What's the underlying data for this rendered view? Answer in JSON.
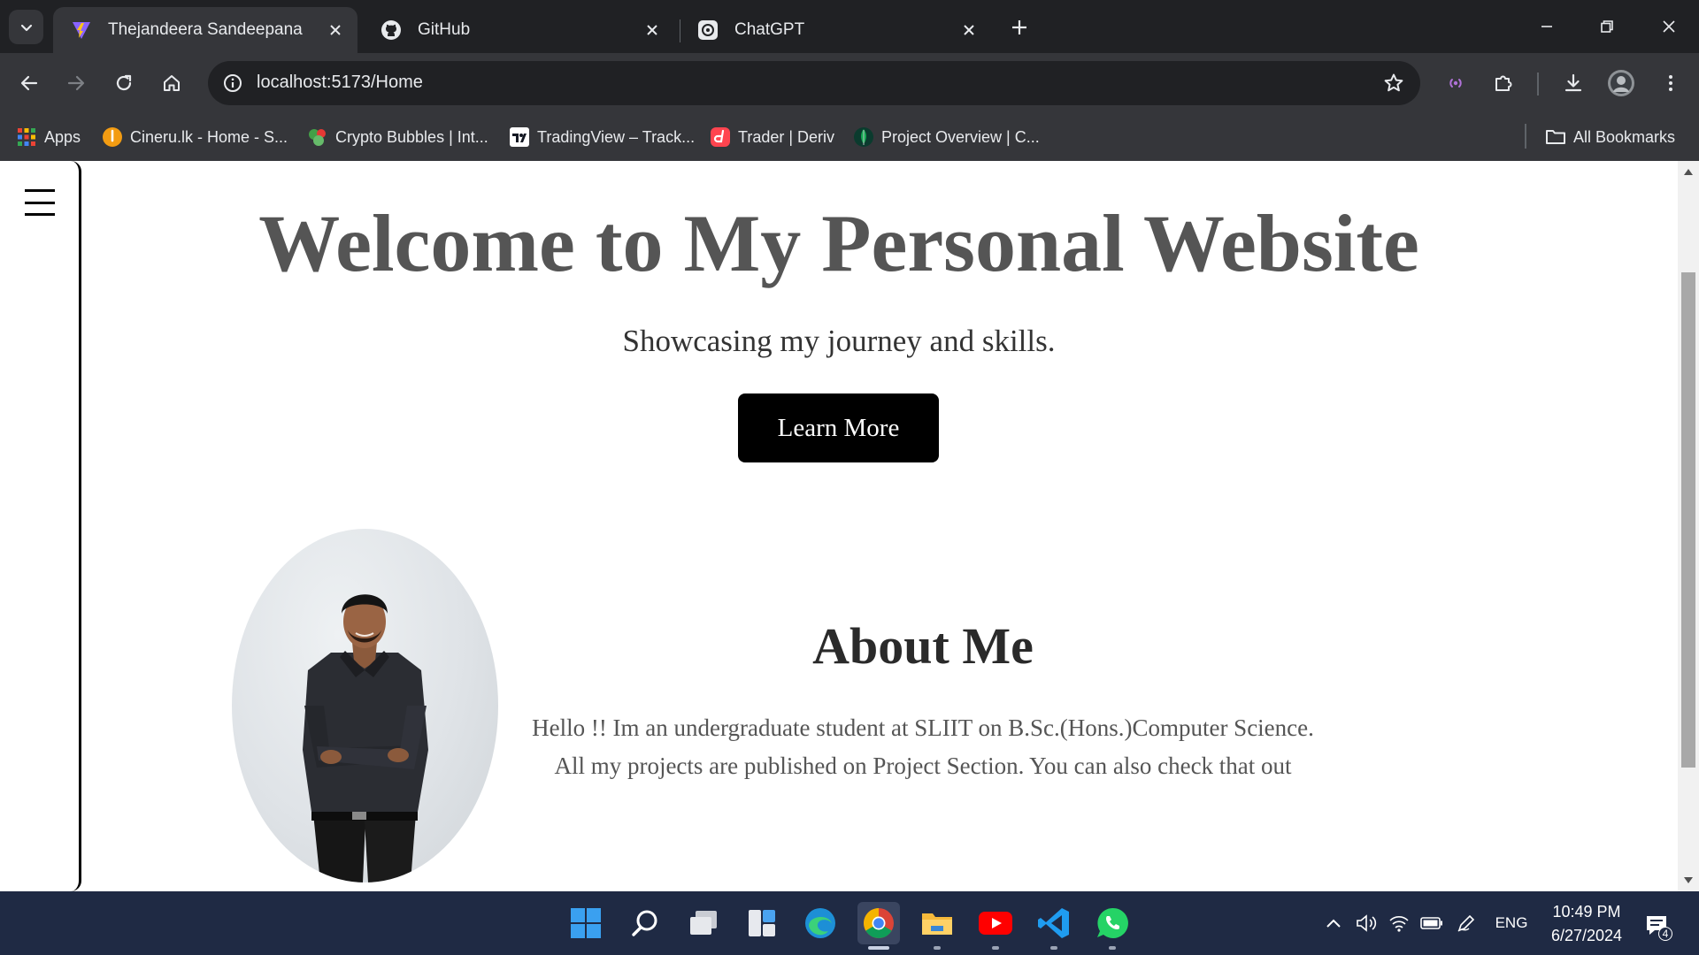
{
  "browser": {
    "tabs": [
      {
        "title": "Thejandeera Sandeepana",
        "icon": "vite-icon",
        "active": true
      },
      {
        "title": "GitHub",
        "icon": "github-icon",
        "active": false
      },
      {
        "title": "ChatGPT",
        "icon": "chatgpt-icon",
        "active": false
      }
    ],
    "url": "localhost:5173/Home",
    "bookmarks": [
      {
        "label": "Apps",
        "icon": "apps-grid-icon"
      },
      {
        "label": "Cineru.lk - Home - S...",
        "icon": "cineru-icon"
      },
      {
        "label": "Crypto Bubbles | Int...",
        "icon": "crypto-bubbles-icon"
      },
      {
        "label": "TradingView – Track...",
        "icon": "tradingview-icon"
      },
      {
        "label": "Trader | Deriv",
        "icon": "deriv-icon"
      },
      {
        "label": "Project Overview | C...",
        "icon": "mongodb-leaf-icon"
      }
    ],
    "all_bookmarks_label": "All Bookmarks"
  },
  "page": {
    "hero": {
      "title": "Welcome to My Personal Website",
      "subtitle": "Showcasing my journey and skills.",
      "button_label": "Learn More"
    },
    "about": {
      "title": "About Me",
      "text": "Hello !! Im an undergraduate student at SLIIT on B.Sc.(Hons.)Computer Science. All my projects are published on Project Section. You can also check that out"
    }
  },
  "taskbar": {
    "apps": [
      "windows-start-icon",
      "search-icon",
      "task-view-icon",
      "widgets-icon",
      "edge-icon",
      "chrome-icon",
      "file-explorer-icon",
      "youtube-icon",
      "vscode-icon",
      "whatsapp-icon"
    ],
    "language": "ENG",
    "time": "10:49 PM",
    "date": "6/27/2024",
    "notification_count": "4"
  },
  "colors": {
    "tab_strip": "#202124",
    "toolbar": "#35363a",
    "hero_title": "#555555",
    "button_bg": "#000000",
    "taskbar": "#1f2a44"
  }
}
